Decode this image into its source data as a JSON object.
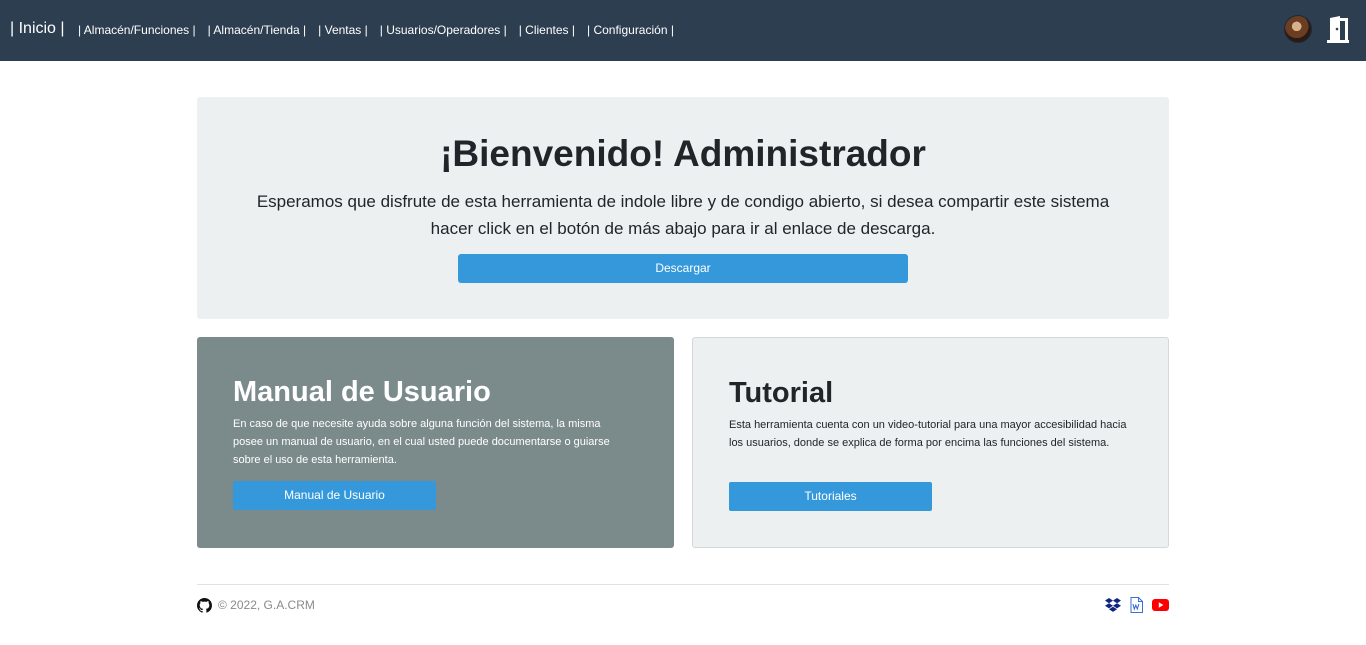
{
  "navbar": {
    "brand": "| Inicio |",
    "links": [
      "| Almacén/Funciones |",
      "| Almacén/Tienda |",
      "| Ventas |",
      "| Usuarios/Operadores |",
      "| Clientes |",
      "| Configuración |"
    ],
    "icons": [
      "user-avatar",
      "logout-door-icon"
    ]
  },
  "jumbotron": {
    "title": "¡Bienvenido! Administrador",
    "lead": "Esperamos que disfrute de esta herramienta de indole libre y de condigo abierto, si desea compartir este sistema hacer click en el botón de más abajo para ir al enlace de descarga.",
    "button": "Descargar"
  },
  "cards": {
    "manual": {
      "title": "Manual de Usuario",
      "text": "En caso de que necesite ayuda sobre alguna función del sistema, la misma posee un manual de usuario, en el cual usted puede documentarse o guiarse sobre el uso de esta herramienta.",
      "button": "Manual de Usuario"
    },
    "tutorial": {
      "title": "Tutorial",
      "text": "Esta herramienta cuenta con un video-tutorial para una mayor accesibilidad hacia los usuarios, donde se explica de forma por encima las funciones del sistema.",
      "button": "Tutoriales"
    }
  },
  "footer": {
    "copyright": "© 2022, G.A.CRM",
    "icons": [
      "github-icon",
      "dropbox-icon",
      "word-document-icon",
      "youtube-icon"
    ]
  },
  "colors": {
    "navbar": "#2c3e50",
    "primary": "#3498db",
    "jumbotron": "#ecf0f1",
    "manual_card": "#7b8a8b",
    "youtube": "#ff0000",
    "dropbox": "#0d2481"
  }
}
